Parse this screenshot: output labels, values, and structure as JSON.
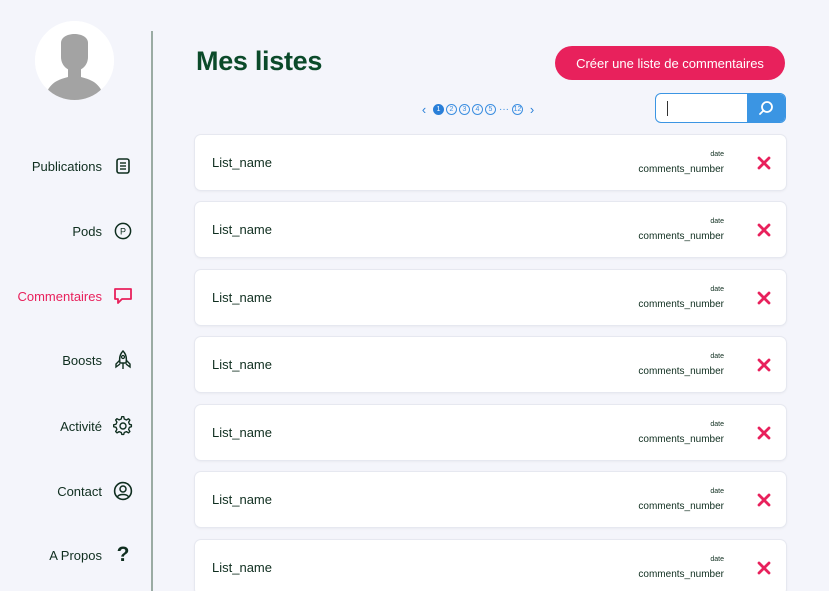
{
  "sidebar": {
    "avatar_icon": "user-silhouette-icon",
    "items": [
      {
        "label": "Publications",
        "icon": "document-icon",
        "active": false
      },
      {
        "label": "Pods",
        "icon": "p-circle-icon",
        "active": false
      },
      {
        "label": "Commentaires",
        "icon": "comment-icon",
        "active": true
      },
      {
        "label": "Boosts",
        "icon": "rocket-icon",
        "active": false
      },
      {
        "label": "Activité",
        "icon": "gear-icon",
        "active": false
      },
      {
        "label": "Contact",
        "icon": "user-circle-icon",
        "active": false
      },
      {
        "label": "A Propos",
        "icon": "question-icon",
        "active": false
      }
    ],
    "active_color": "#e8215c"
  },
  "header": {
    "title": "Mes listes",
    "create_button_label": "Créer une liste de commentaires"
  },
  "pagination": {
    "prev": "‹",
    "next": "›",
    "pages": [
      "1",
      "2",
      "3",
      "4",
      "5"
    ],
    "ellipsis": "···",
    "last_page": "12",
    "current_page": "1"
  },
  "search": {
    "value": "",
    "icon": "search-icon"
  },
  "lists": [
    {
      "name": "List_name",
      "date": "date",
      "comments": "comments_number"
    },
    {
      "name": "List_name",
      "date": "date",
      "comments": "comments_number"
    },
    {
      "name": "List_name",
      "date": "date",
      "comments": "comments_number"
    },
    {
      "name": "List_name",
      "date": "date",
      "comments": "comments_number"
    },
    {
      "name": "List_name",
      "date": "date",
      "comments": "comments_number"
    },
    {
      "name": "List_name",
      "date": "date",
      "comments": "comments_number"
    },
    {
      "name": "List_name",
      "date": "date",
      "comments": "comments_number"
    }
  ],
  "colors": {
    "accent": "#e8215c",
    "title_green": "#0b4a2a",
    "link_blue": "#3b95e3",
    "background": "#f4f5fb"
  }
}
